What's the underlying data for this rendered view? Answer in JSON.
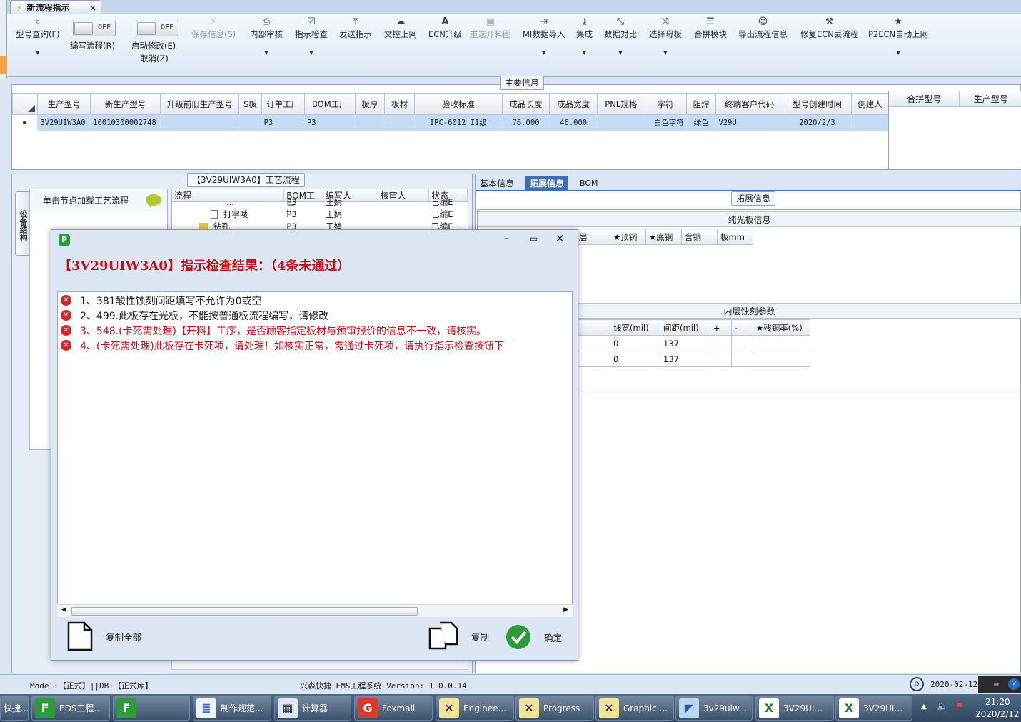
{
  "tab": {
    "title": "新流程指示",
    "close": "×"
  },
  "ribbon": {
    "items": [
      {
        "key": "model_query",
        "label": "型号查询(F)",
        "icon": "search-icon",
        "glyph": "⌕"
      },
      {
        "key": "save",
        "label": "保存信息(S)",
        "icon": "lightning-icon",
        "glyph": "⚡"
      },
      {
        "key": "internal_review",
        "label": "内部审核",
        "icon": "printer-icon",
        "glyph": "⎙"
      },
      {
        "key": "check",
        "label": "指示检查",
        "icon": "check-box-icon",
        "glyph": "☑"
      },
      {
        "key": "send",
        "label": "发送指示",
        "icon": "upload-icon",
        "glyph": "⤒"
      },
      {
        "key": "doc_upload",
        "label": "文控上网",
        "icon": "cloud-upload-icon",
        "glyph": "☁"
      },
      {
        "key": "ecn",
        "label": "ECN升级",
        "icon": "ecn-icon",
        "glyph": "A"
      },
      {
        "key": "reselect",
        "label": "重选开料图",
        "icon": "image-icon",
        "glyph": "▣"
      },
      {
        "key": "mi_import",
        "label": "MI数据导入",
        "icon": "import-icon",
        "glyph": "⇥"
      },
      {
        "key": "integrate",
        "label": "集成",
        "icon": "download-icon",
        "glyph": "⤓"
      },
      {
        "key": "compare",
        "label": "数据对比",
        "icon": "compare-icon",
        "glyph": "⤡"
      },
      {
        "key": "mother_board",
        "label": "选择母板",
        "icon": "shuffle-icon",
        "glyph": "⤨"
      },
      {
        "key": "panel_module",
        "label": "合拼模块",
        "icon": "list-icon",
        "glyph": "☰"
      },
      {
        "key": "export_flow",
        "label": "导出流程信息",
        "icon": "smiley-icon",
        "glyph": "☺"
      },
      {
        "key": "fix_ecn",
        "label": "修复ECN丢流程",
        "icon": "wrench-icon",
        "glyph": "🔧"
      },
      {
        "key": "p2ecn",
        "label": "P2ECN自动上网",
        "icon": "star-icon",
        "glyph": "★"
      }
    ],
    "toggle_write": {
      "state": "OFF",
      "label": "编写流程(R)"
    },
    "toggle_modify": {
      "state": "OFF",
      "label": "启动修改(E)",
      "sublabel": "取消(Z)"
    }
  },
  "main_info": {
    "title": "主要信息",
    "columns": [
      "生产型号",
      "新生产型号",
      "升级前旧生产型号",
      "S板",
      "订单工厂",
      "BOM工厂",
      "板厚",
      "板材",
      "验收标准",
      "成品长度",
      "成品宽度",
      "PNL规格",
      "字符",
      "阻焊",
      "终端客户代码",
      "型号创建时间",
      "创建人"
    ],
    "row": [
      "3V29UIW3A0",
      "10010300002748",
      "",
      "",
      "P3",
      "P3",
      "",
      "",
      "IPC-6012 II级",
      "76.000",
      "46.000",
      "",
      "白色字符",
      "绿色",
      "V29U",
      "2020/2/3",
      ""
    ],
    "side_columns": [
      "合拼型号",
      "生产型号"
    ]
  },
  "process": {
    "title": "【3V29UIW3A0】工艺流程",
    "vertical_tab": "设备结构",
    "add_node": "单击节点加载工艺流程",
    "columns": [
      "流程",
      "BOM工厂",
      "编写人",
      "核审人",
      "状态"
    ],
    "rows": [
      {
        "name": "...",
        "bom": "P3",
        "writer": "王娟",
        "reviewer": "",
        "status": "已编E"
      },
      {
        "name": "打字唛",
        "bom": "P3",
        "writer": "王娟",
        "reviewer": "",
        "status": "已编E"
      },
      {
        "name": "钻孔",
        "bom": "P3",
        "writer": "王娟",
        "reviewer": "",
        "status": "已编E"
      }
    ]
  },
  "right_panel": {
    "tabs": [
      "基本信息",
      "拓展信息",
      "BOM"
    ],
    "active_tab": "拓展信息",
    "section_title": "拓展信息",
    "plain_board": {
      "title": "纯光板信息",
      "columns": [
        "层",
        "★顶铜",
        "★底铜",
        "含铜",
        "板mm"
      ]
    },
    "inner_etch": {
      "title": "内层蚀刻参数",
      "columns": [
        "线宽(mil)",
        "间距(mil)",
        "+",
        "-",
        "★残铜率(%)"
      ],
      "rows": [
        [
          "0",
          "137",
          "",
          "",
          ""
        ],
        [
          "0",
          "137",
          "",
          "",
          ""
        ]
      ]
    }
  },
  "dialog": {
    "heading": "【3V29UIW3A0】指示检查结果：（4条未通过）",
    "errors": [
      {
        "text": "1、381酸性蚀刻间距填写不允许为0或空",
        "color": "#1a1a1a"
      },
      {
        "text": "2、499.此板存在光板，不能按普通板流程编写，请修改",
        "color": "#1a1a1a"
      },
      {
        "text": "3、548.(卡死需处理)【开料】工序，是否顾客指定板材与预审报价的信息不一致，请核实。",
        "color": "#c0101c"
      },
      {
        "text": "4、(卡死需处理)此板存在卡死项，请处理！如核实正常，需通过卡死项，请执行指示检查按钮下",
        "color": "#c0101c"
      }
    ],
    "copy_all": "复制全部",
    "copy": "复制",
    "ok": "确定"
  },
  "statusbar": {
    "left": "Model:【正式】||DB:【正式库】",
    "center": "兴森快捷 EMS工程系统 Version: 1.0.0.14",
    "date": "2020-02-12"
  },
  "taskbar": {
    "items": [
      {
        "label": "快捷...",
        "icon": "app-icon"
      },
      {
        "label": "EDS工程...",
        "icon": "eds-app-icon"
      },
      {
        "label": "",
        "icon": "eds-app-icon"
      },
      {
        "label": "制作规范...",
        "icon": "document-icon"
      },
      {
        "label": "计算器",
        "icon": "calculator-icon"
      },
      {
        "label": "Foxmail",
        "icon": "foxmail-icon"
      },
      {
        "label": "Enginee...",
        "icon": "excel-x-icon"
      },
      {
        "label": "Progress",
        "icon": "excel-x-icon"
      },
      {
        "label": "Graphic ...",
        "icon": "excel-x-icon"
      },
      {
        "label": "3v29uiw...",
        "icon": "folder-icon"
      },
      {
        "label": "3V29UI...",
        "icon": "excel-icon"
      },
      {
        "label": "3V29UI...",
        "icon": "excel-icon"
      }
    ],
    "time": "21:20",
    "date": "2020/2/12"
  }
}
